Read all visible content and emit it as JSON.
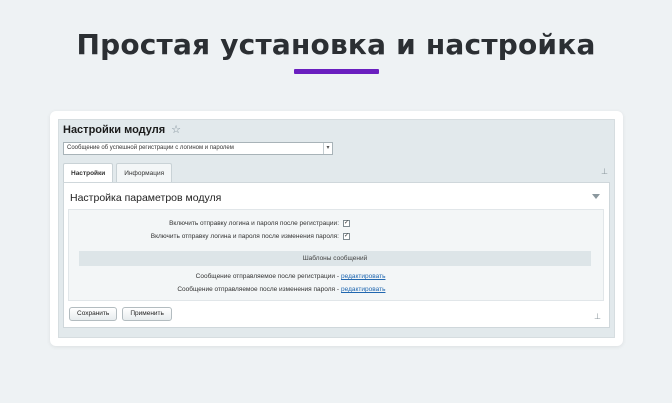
{
  "hero": {
    "title": "Простая установка и настройка"
  },
  "panel": {
    "title": "Настройки модуля",
    "select_value": "Сообщение об успешной регистрации с логином и паролем"
  },
  "tabs": [
    {
      "label": "Настройки",
      "active": true
    },
    {
      "label": "Информация",
      "active": false
    }
  ],
  "section": {
    "title": "Настройка параметров модуля",
    "options": [
      {
        "label": "Включить отправку логина и пароля после регистрации:",
        "checked": true
      },
      {
        "label": "Включить отправку логина и пароля после изменения пароля:",
        "checked": true
      }
    ],
    "templates_header": "Шаблоны сообщений",
    "templates": [
      {
        "label": "Сообщение отправляемое после регистрации -",
        "link": "редактировать"
      },
      {
        "label": "Сообщение отправляемое после изменения пароля -",
        "link": "редактировать"
      }
    ]
  },
  "buttons": {
    "save": "Сохранить",
    "apply": "Применить"
  },
  "colors": {
    "accent": "#6a1fbf",
    "link": "#2067b0"
  }
}
